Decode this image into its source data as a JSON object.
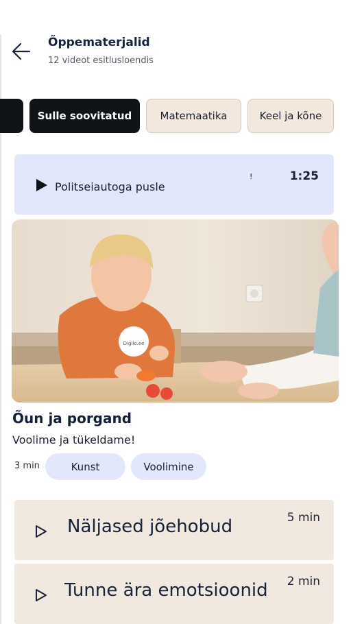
{
  "header": {
    "back_icon": "arrow-left-icon",
    "title": "Õppematerjalid",
    "subtitle": "12 videot esitlusloendis"
  },
  "chips": [
    {
      "label": "",
      "selected": true
    },
    {
      "label": "Sulle soovitatud",
      "selected": true
    },
    {
      "label": "Matemaatika",
      "selected": false
    },
    {
      "label": "Keel ja kõne",
      "selected": false
    }
  ],
  "now_playing": {
    "icon": "play-icon",
    "title": "Politseiautoga pusle",
    "dot": "!",
    "duration": "1:25"
  },
  "featured": {
    "thumbnail_logo": "Digilo.ee",
    "title": "Õun ja porgand",
    "description": "Voolime ja tükeldame!",
    "duration": "3 min",
    "tags": [
      "Kunst",
      "Voolimine"
    ]
  },
  "list": [
    {
      "icon": "play-outline-icon",
      "title": "Näljased jõehobud",
      "duration": "5 min"
    },
    {
      "icon": "play-outline-icon",
      "title": "Tunne ära emotsioonid",
      "duration": "2 min"
    }
  ],
  "colors": {
    "accent_dark": "#101317",
    "chip_light": "#f3e8dd",
    "lavender": "#e3e7fb",
    "list_bg": "#f1e9df",
    "text_primary": "#16213a"
  }
}
